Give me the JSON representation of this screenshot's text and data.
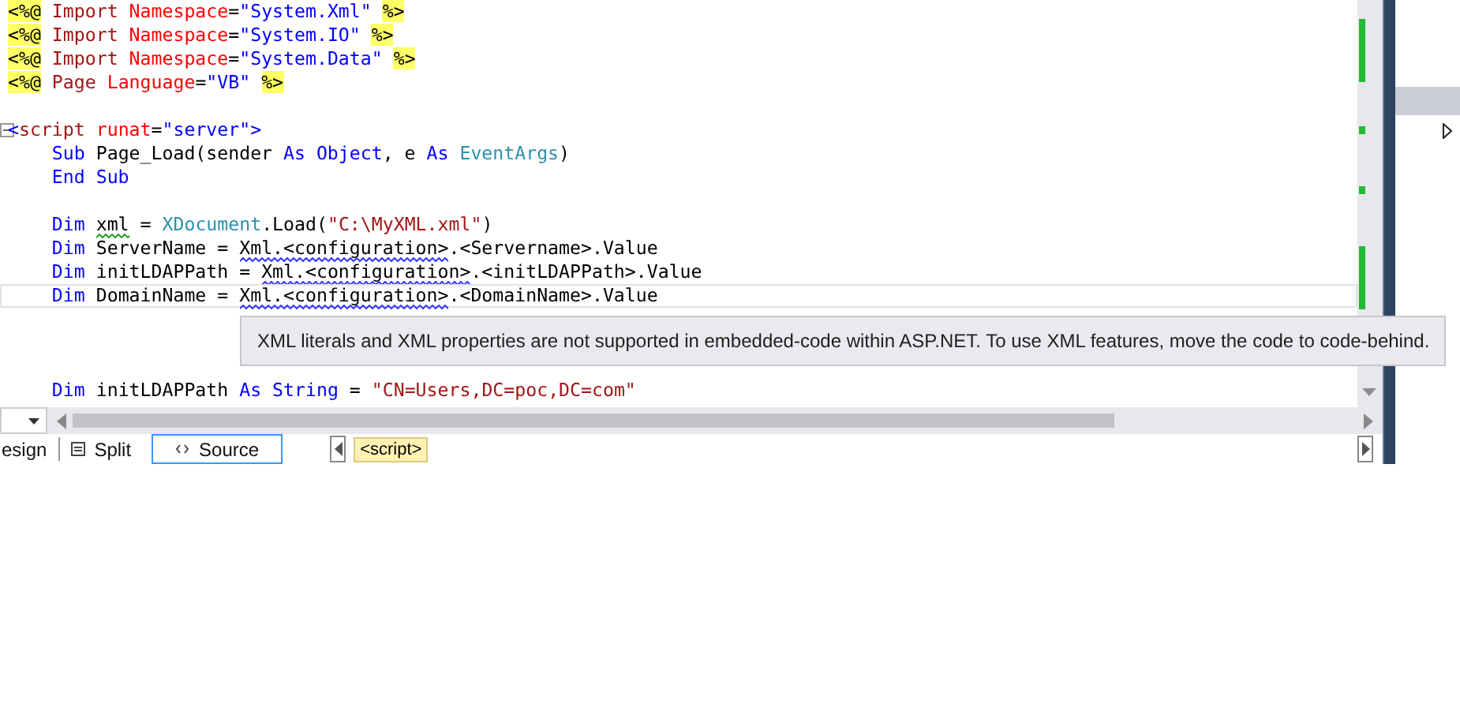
{
  "editor": {
    "lines": [
      {
        "kind": "code",
        "tokens": [
          {
            "t": "<%@",
            "kind": "directive"
          },
          {
            "t": " Import ",
            "kind": "element"
          },
          {
            "t": "Namespace",
            "kind": "attr"
          },
          {
            "t": "=",
            "kind": "plain"
          },
          {
            "t": "\"System.Xml\" ",
            "kind": "value"
          },
          {
            "t": "%>",
            "kind": "directive"
          }
        ]
      },
      {
        "kind": "code",
        "tokens": [
          {
            "t": "<%@",
            "kind": "directive"
          },
          {
            "t": " Import ",
            "kind": "element"
          },
          {
            "t": "Namespace",
            "kind": "attr"
          },
          {
            "t": "=",
            "kind": "plain"
          },
          {
            "t": "\"System.IO\" ",
            "kind": "value"
          },
          {
            "t": "%>",
            "kind": "directive"
          }
        ]
      },
      {
        "kind": "code",
        "tokens": [
          {
            "t": "<%@",
            "kind": "directive"
          },
          {
            "t": " Import ",
            "kind": "element"
          },
          {
            "t": "Namespace",
            "kind": "attr"
          },
          {
            "t": "=",
            "kind": "plain"
          },
          {
            "t": "\"System.Data\" ",
            "kind": "value"
          },
          {
            "t": "%>",
            "kind": "directive"
          }
        ]
      },
      {
        "kind": "code",
        "tokens": [
          {
            "t": "<%@",
            "kind": "directive"
          },
          {
            "t": " Page ",
            "kind": "element"
          },
          {
            "t": "Language",
            "kind": "attr"
          },
          {
            "t": "=",
            "kind": "plain"
          },
          {
            "t": "\"VB\" ",
            "kind": "value"
          },
          {
            "t": "%>",
            "kind": "directive"
          }
        ]
      },
      {
        "kind": "blank"
      },
      {
        "kind": "code",
        "fold": true,
        "tokens": [
          {
            "t": "<",
            "kind": "bracket"
          },
          {
            "t": "script",
            "kind": "element"
          },
          {
            "t": " runat",
            "kind": "attr"
          },
          {
            "t": "=",
            "kind": "plain"
          },
          {
            "t": "\"server\"",
            "kind": "value"
          },
          {
            "t": ">",
            "kind": "bracket"
          }
        ]
      },
      {
        "kind": "code",
        "tokens": [
          {
            "t": "    Sub",
            "kind": "keyword"
          },
          {
            "t": " Page_Load(sender ",
            "kind": "plain"
          },
          {
            "t": "As Object",
            "kind": "keyword"
          },
          {
            "t": ", e ",
            "kind": "plain"
          },
          {
            "t": "As ",
            "kind": "keyword"
          },
          {
            "t": "EventArgs",
            "kind": "type"
          },
          {
            "t": ")",
            "kind": "plain"
          }
        ]
      },
      {
        "kind": "code",
        "tokens": [
          {
            "t": "    End Sub",
            "kind": "keyword"
          }
        ]
      },
      {
        "kind": "blank"
      },
      {
        "kind": "code",
        "tokens": [
          {
            "t": "    Dim ",
            "kind": "keyword"
          },
          {
            "t": "xml",
            "kind": "plain",
            "squiggle": {
              "color": "#2ca02c"
            }
          },
          {
            "t": " = ",
            "kind": "plain"
          },
          {
            "t": "XDocument",
            "kind": "type"
          },
          {
            "t": ".Load(",
            "kind": "plain"
          },
          {
            "t": "\"C:\\MyXML.xml\"",
            "kind": "string"
          },
          {
            "t": ")",
            "kind": "plain"
          }
        ]
      },
      {
        "kind": "code",
        "tokens": [
          {
            "t": "    Dim",
            "kind": "keyword"
          },
          {
            "t": " ServerName = ",
            "kind": "plain"
          },
          {
            "t": "Xml.<configuration>",
            "kind": "plain",
            "squiggle": {
              "color": "#3a3aff"
            }
          },
          {
            "t": ".<Servername>.Value",
            "kind": "plain"
          }
        ]
      },
      {
        "kind": "code",
        "tokens": [
          {
            "t": "    Dim",
            "kind": "keyword"
          },
          {
            "t": " initLDAPPath = ",
            "kind": "plain"
          },
          {
            "t": "Xml.<configuration>",
            "kind": "plain",
            "squiggle": {
              "color": "#3a3aff"
            }
          },
          {
            "t": ".<initLDAPPath>.Value",
            "kind": "plain"
          }
        ]
      },
      {
        "kind": "code",
        "current": true,
        "tokens": [
          {
            "t": "    Dim",
            "kind": "keyword"
          },
          {
            "t": " DomainName = ",
            "kind": "plain"
          },
          {
            "t": "Xml.<configuration>",
            "kind": "plain",
            "squiggle": {
              "color": "#3a3aff"
            }
          },
          {
            "t": ".<DomainName>.Value",
            "kind": "plain"
          }
        ]
      },
      {
        "kind": "blank"
      },
      {
        "kind": "blank"
      },
      {
        "kind": "blank"
      },
      {
        "kind": "code",
        "tokens": [
          {
            "t": "    Dim",
            "kind": "keyword"
          },
          {
            "t": " initLDAPPath ",
            "kind": "plain"
          },
          {
            "t": "As String",
            "kind": "keyword"
          },
          {
            "t": " = ",
            "kind": "plain"
          },
          {
            "t": "\"CN=Users,DC=poc,DC=com\"",
            "kind": "string"
          }
        ]
      }
    ],
    "tooltip": "XML literals and XML properties are not supported in embedded-code within ASP.NET. To use XML features, move the code to code-behind."
  },
  "view_tabs": [
    {
      "label": "esign",
      "kind": "design",
      "selected": false
    },
    {
      "label": "Split",
      "kind": "split",
      "selected": false
    },
    {
      "label": "Source",
      "kind": "source",
      "selected": true
    }
  ],
  "breadcrumb": "<script>"
}
